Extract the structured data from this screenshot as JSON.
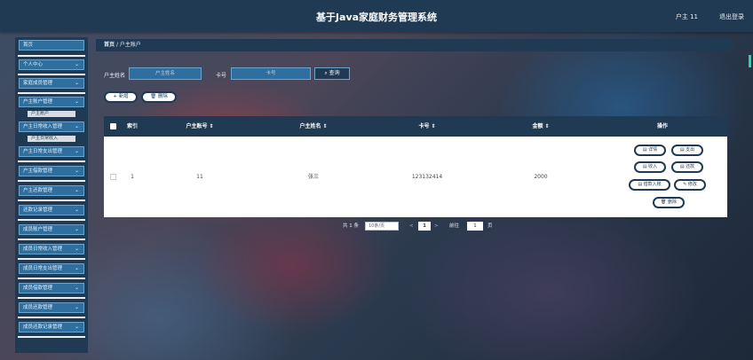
{
  "header": {
    "title": "基于Java家庭财务管理系统",
    "user": "户主 11",
    "logout": "退出登录"
  },
  "sidebar": {
    "items": [
      {
        "label": "首页",
        "chevron": ""
      },
      {
        "label": "个人中心",
        "chevron": "⌄"
      },
      {
        "label": "家庭成员管理",
        "chevron": "⌄"
      },
      {
        "label": "户主账户管理",
        "chevron": "⌄"
      },
      {
        "label": "户主日常收入管理",
        "chevron": "⌄"
      },
      {
        "label": "户主日常支出管理",
        "chevron": "⌄"
      },
      {
        "label": "户主借款管理",
        "chevron": "⌄"
      },
      {
        "label": "户主还款管理",
        "chevron": "⌄"
      },
      {
        "label": "还款记录管理",
        "chevron": "⌄"
      },
      {
        "label": "成员账户管理",
        "chevron": "⌄"
      },
      {
        "label": "成员日常收入管理",
        "chevron": "⌄"
      },
      {
        "label": "成员日常支出管理",
        "chevron": "⌄"
      },
      {
        "label": "成员借款管理",
        "chevron": "⌄"
      },
      {
        "label": "成员还款管理",
        "chevron": "⌄"
      },
      {
        "label": "成员还款记录管理",
        "chevron": "⌄"
      }
    ],
    "sub_items": [
      "户主账户",
      "户主日常收入"
    ]
  },
  "breadcrumb": {
    "home": "首页",
    "sep": "/",
    "current": "户主账户"
  },
  "search": {
    "name_label": "户主姓名",
    "name_placeholder": "户主姓名",
    "card_label": "卡号",
    "card_placeholder": "卡号",
    "query_button": "⌕ 查询"
  },
  "actions": {
    "add": "+ 新增",
    "delete": "🗑 删除"
  },
  "table": {
    "columns": [
      "索引",
      "户主账号 ⇕",
      "户主姓名 ⇕",
      "卡号 ⇕",
      "金额 ⇕",
      "操作"
    ],
    "rows": [
      {
        "index": "1",
        "account": "11",
        "name": "张三",
        "card": "123132414",
        "amount": "2000"
      }
    ],
    "row_actions": [
      "▤ 详情",
      "▤ 支出",
      "▤ 收入",
      "▤ 还款",
      "▤ 借款入账",
      "✎ 修改",
      "🗑 删除"
    ]
  },
  "pagination": {
    "total": "共 1 条",
    "page_size": "10条/页",
    "prev": "<",
    "current": "1",
    "next": ">",
    "goto_label": "前往",
    "goto_value": "1",
    "page_suffix": "页"
  }
}
